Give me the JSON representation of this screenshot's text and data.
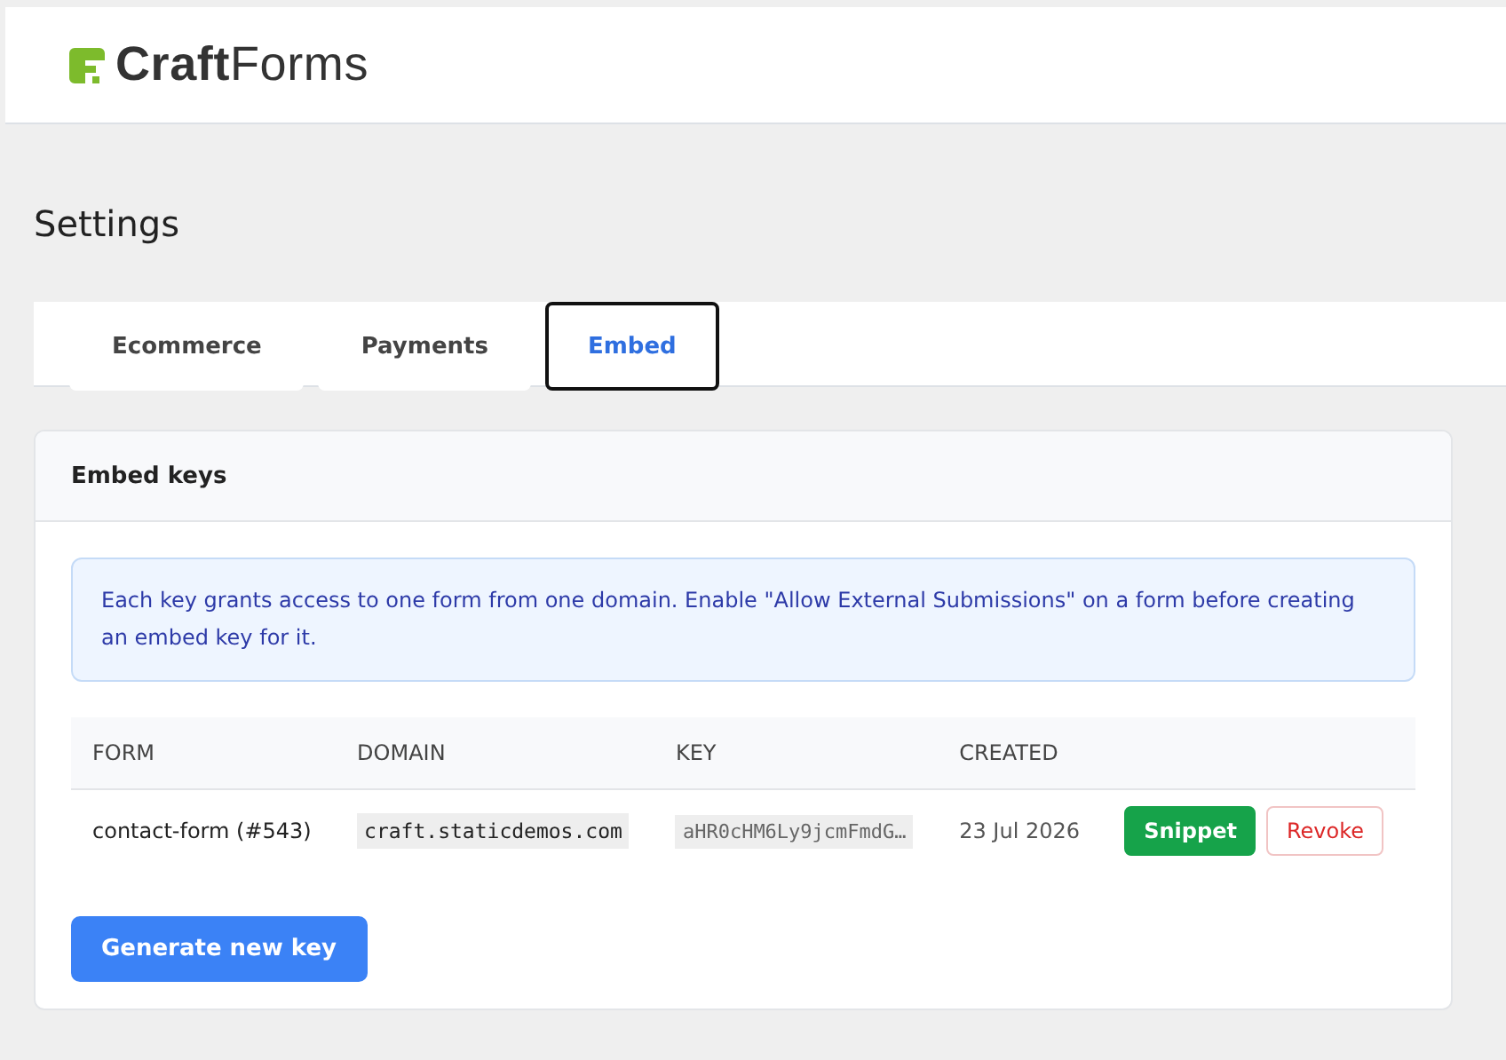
{
  "header": {
    "logo": "**Craft**Forms"
  },
  "page_title": "Settings",
  "tabs": [
    {
      "label": "Ecommerce",
      "selected": false
    },
    {
      "label": "Payments",
      "selected": false
    },
    {
      "label": "Embed",
      "selected": true
    }
  ],
  "card": {
    "title": "Embed keys",
    "notice": "Each key grants access to one form from one domain. Enable \"Allow External Submissions\" on a form before creating an embed key for it.",
    "table": {
      "columns": [
        "FORM",
        "DOMAIN",
        "KEY",
        "CREATED"
      ],
      "rows": [
        {
          "form": "contact-form (#543)",
          "domain": "craft.staticdemos.com",
          "key": "aHR0cHM6Ly9jcmFmdG…",
          "created": "23 Jul 2026",
          "actions": [
            {
              "label": "Snippet",
              "kind": "primary"
            },
            {
              "label": "Revoke",
              "kind": "danger"
            }
          ]
        }
      ]
    },
    "button": "Generate new key"
  }
}
